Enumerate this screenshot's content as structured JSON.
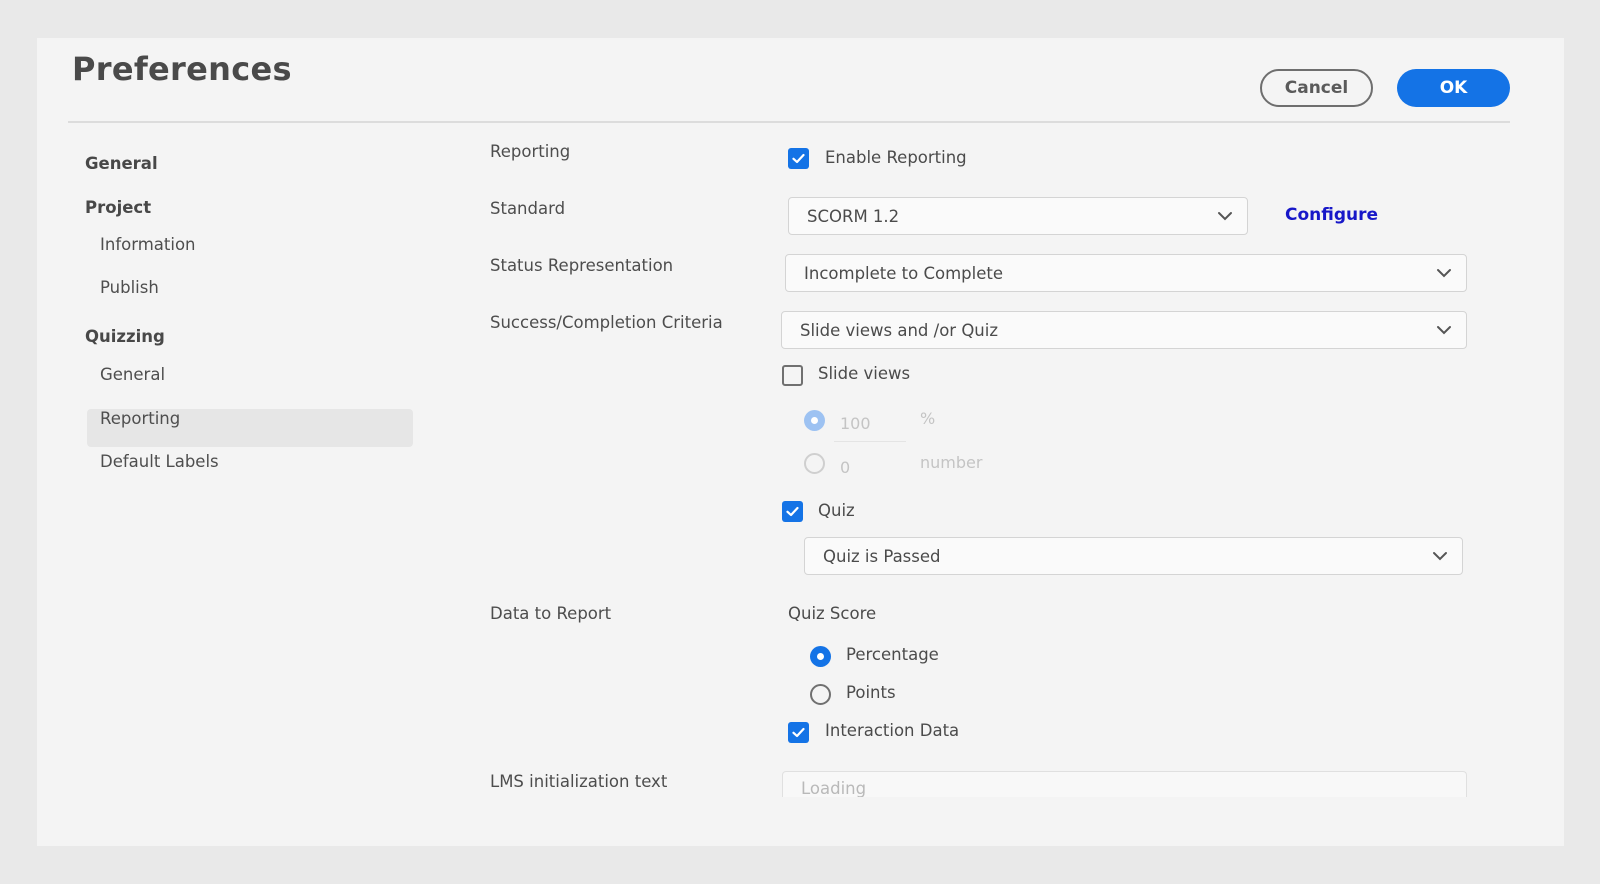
{
  "dialog": {
    "title": "Preferences",
    "cancel_label": "Cancel",
    "ok_label": "OK"
  },
  "sidebar": {
    "items": [
      {
        "label": "General",
        "type": "section"
      },
      {
        "label": "Project",
        "type": "section"
      },
      {
        "label": "Information",
        "type": "sub"
      },
      {
        "label": "Publish",
        "type": "sub"
      },
      {
        "label": "Quizzing",
        "type": "section"
      },
      {
        "label": "General",
        "type": "sub"
      },
      {
        "label": "Reporting",
        "type": "sub",
        "selected": true
      },
      {
        "label": "Default Labels",
        "type": "sub"
      }
    ]
  },
  "form": {
    "reporting": {
      "label": "Reporting",
      "enable_reporting": {
        "label": "Enable Reporting",
        "checked": true
      }
    },
    "standard": {
      "label": "Standard",
      "value": "SCORM 1.2",
      "configure_label": "Configure"
    },
    "status_representation": {
      "label": "Status Representation",
      "value": "Incomplete to Complete"
    },
    "success_criteria": {
      "label": "Success/Completion Criteria",
      "value": "Slide views and /or Quiz",
      "slide_views": {
        "label": "Slide views",
        "checked": false,
        "percent_option": {
          "value": "100",
          "unit": "%",
          "selected": true,
          "disabled": true
        },
        "number_option": {
          "value": "0",
          "unit": "number",
          "selected": false,
          "disabled": true
        }
      },
      "quiz": {
        "label": "Quiz",
        "checked": true,
        "value": "Quiz is Passed"
      }
    },
    "data_to_report": {
      "label": "Data to Report",
      "quiz_score_label": "Quiz Score",
      "options": [
        {
          "label": "Percentage",
          "selected": true
        },
        {
          "label": "Points",
          "selected": false
        }
      ],
      "interaction_data": {
        "label": "Interaction Data",
        "checked": true
      }
    },
    "lms_init": {
      "label": "LMS initialization text",
      "placeholder": "Loading"
    }
  },
  "colors": {
    "accent": "#1473e6",
    "link": "#1717c8",
    "background": "#f4f4f4"
  }
}
